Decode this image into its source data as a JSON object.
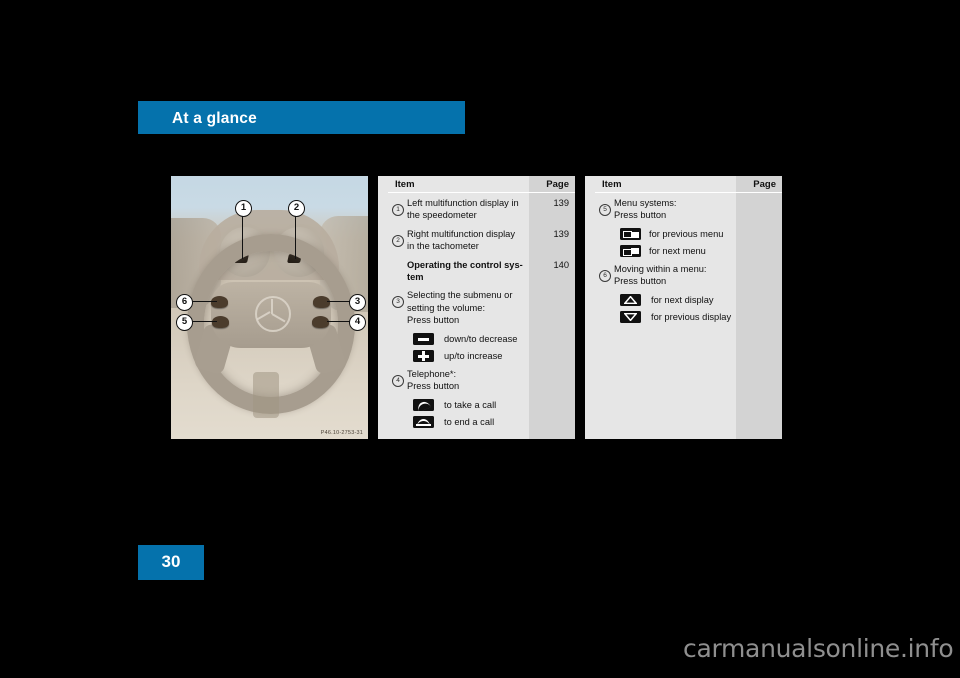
{
  "header": {
    "title": "At a glance",
    "banner_color": "#0572ac"
  },
  "page_number": "30",
  "figure": {
    "caption": "P46.10-2753-31",
    "callouts": [
      "1",
      "2",
      "3",
      "4",
      "5",
      "6"
    ],
    "alt": "steering-wheel-controls-photo"
  },
  "tables": [
    {
      "headers": {
        "item": "Item",
        "page": "Page"
      },
      "rows": [
        {
          "num": "1",
          "lines": [
            "Left multifunction display in",
            "the speedometer"
          ],
          "page": "139",
          "bold": false
        },
        {
          "num": "2",
          "lines": [
            "Right multifunction display",
            "in the tachometer"
          ],
          "page": "139",
          "bold": false
        },
        {
          "num": "",
          "lines": [
            "Operating the control sys-",
            "tem"
          ],
          "page": "140",
          "bold": true
        },
        {
          "num": "3",
          "lines": [
            "Selecting the submenu or",
            "setting the volume:",
            "Press button"
          ],
          "page": "",
          "bold": false
        }
      ],
      "icon_rows_a": [
        {
          "icon": "minus-button-icon",
          "label": "down/to decrease"
        },
        {
          "icon": "plus-button-icon",
          "label": "up/to increase"
        }
      ],
      "row4": {
        "num": "4",
        "lines": [
          "Telephone*:",
          "Press button"
        ]
      },
      "icon_rows_b": [
        {
          "icon": "phone-take-call-icon",
          "label": "to take a call"
        },
        {
          "icon": "phone-end-call-icon",
          "label": "to end a call"
        }
      ]
    },
    {
      "headers": {
        "item": "Item",
        "page": "Page"
      },
      "row5": {
        "num": "5",
        "lines": [
          "Menu systems:",
          "Press button"
        ]
      },
      "icon_rows_a": [
        {
          "icon": "previous-menu-icon",
          "label": "for previous menu"
        },
        {
          "icon": "next-menu-icon",
          "label": "for next menu"
        }
      ],
      "row6": {
        "num": "6",
        "lines": [
          "Moving within a menu:",
          "Press button"
        ]
      },
      "icon_rows_b": [
        {
          "icon": "arrow-up-icon",
          "label": "for next display"
        },
        {
          "icon": "arrow-down-icon",
          "label": "for previous display"
        }
      ]
    }
  ],
  "watermark": "carmanualsonline.info"
}
